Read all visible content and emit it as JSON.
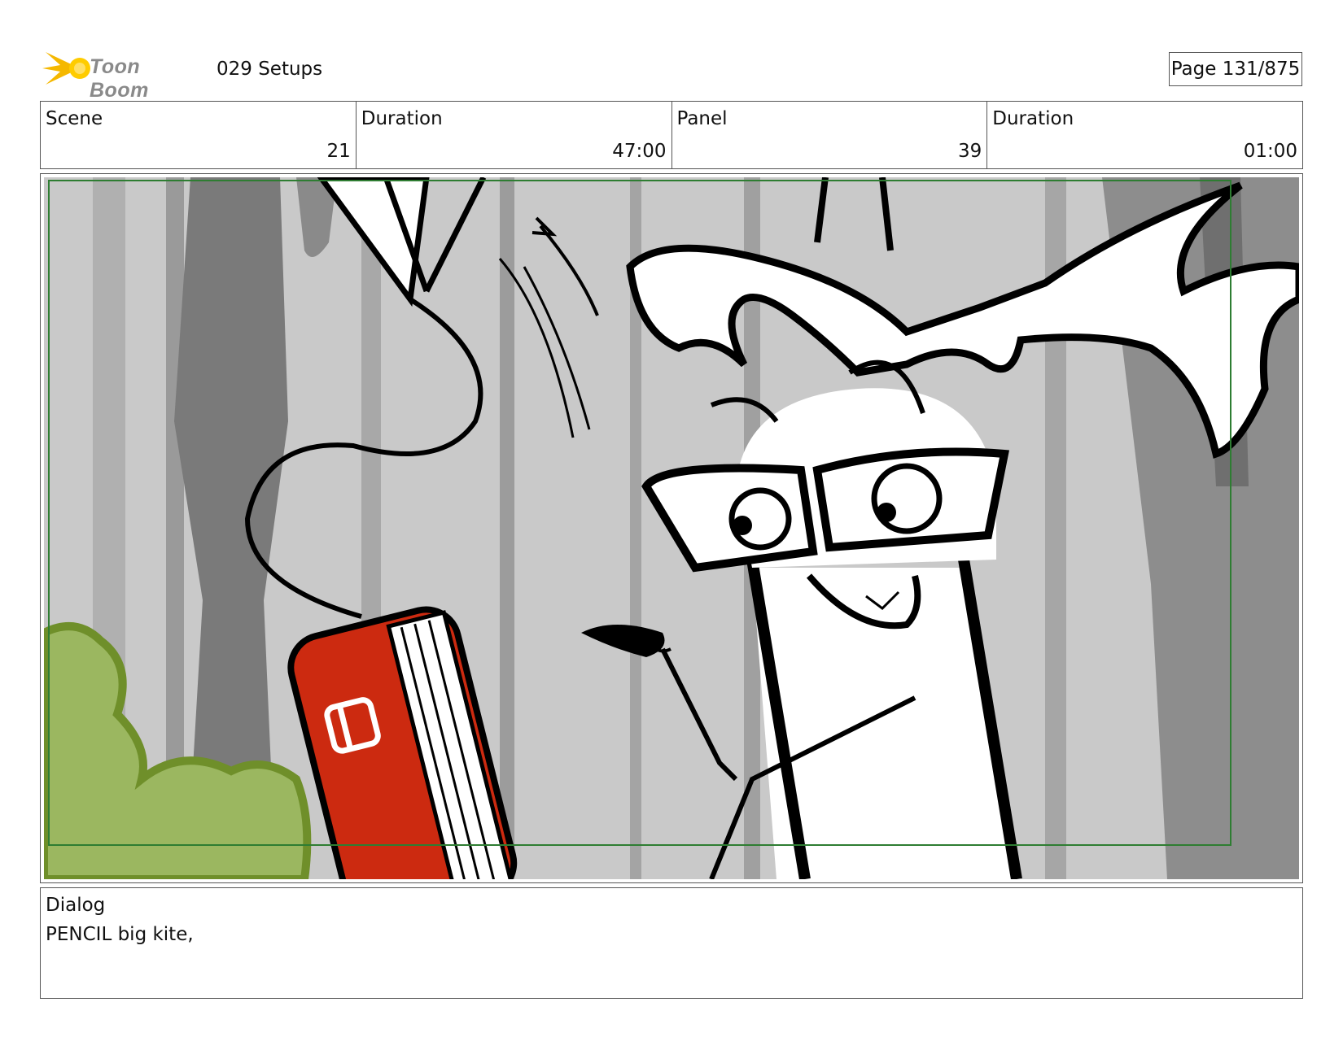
{
  "header": {
    "logo_text": "Toon Boom",
    "setup_title": "029 Setups",
    "page_label": "Page 131/875"
  },
  "info": {
    "scene_label": "Scene",
    "scene_value": "21",
    "scene_duration_label": "Duration",
    "scene_duration_value": "47:00",
    "panel_label": "Panel",
    "panel_value": "39",
    "panel_duration_label": "Duration",
    "panel_duration_value": "01:00"
  },
  "panel": {
    "image_icon": "storyboard-drawing",
    "colors": {
      "background": "#c8c8c8",
      "safe_frame": "#2e7d32",
      "book": "#cc2a10",
      "bush": "#8aa845"
    }
  },
  "dialog": {
    "label": "Dialog",
    "text": "PENCIL big kite,"
  }
}
